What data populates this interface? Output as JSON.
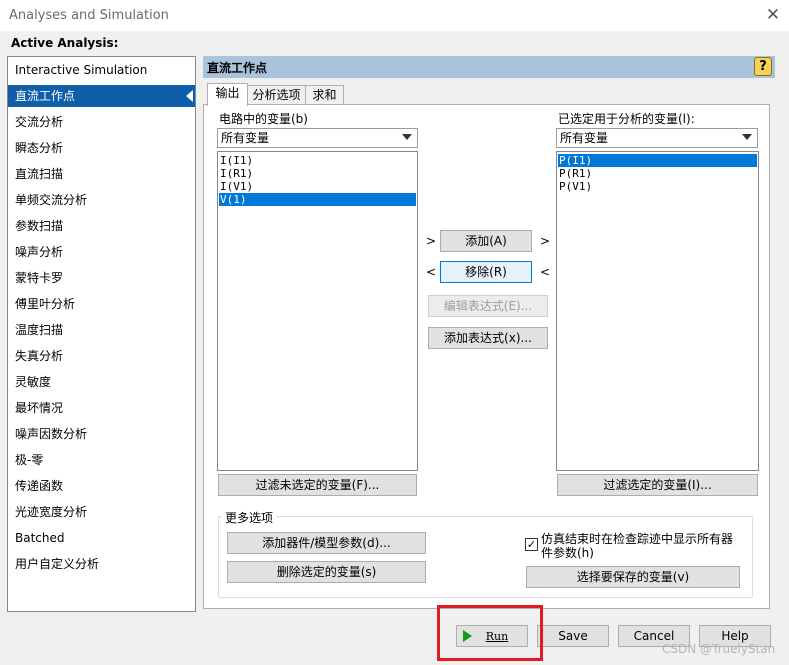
{
  "window": {
    "title": "Analyses and Simulation",
    "close_glyph": "✕"
  },
  "active_analysis_label": "Active Analysis:",
  "analyses": [
    "Interactive Simulation",
    "直流工作点",
    "交流分析",
    "瞬态分析",
    "直流扫描",
    "单频交流分析",
    "参数扫描",
    "噪声分析",
    "蒙特卡罗",
    "傅里叶分析",
    "温度扫描",
    "失真分析",
    "灵敏度",
    "最坏情况",
    "噪声因数分析",
    "极-零",
    "传递函数",
    "光迹宽度分析",
    "Batched",
    "用户自定义分析"
  ],
  "selected_analysis_index": 1,
  "panel": {
    "title": "直流工作点",
    "help_glyph": "?",
    "tabs": [
      "输出",
      "分析选项",
      "求和"
    ],
    "active_tab_index": 0
  },
  "left_list": {
    "label": "电路中的变量(b)",
    "filter_value": "所有变量",
    "items": [
      "I(I1)",
      "I(R1)",
      "I(V1)",
      "V(1)"
    ],
    "selected_index": 3,
    "filter_button": "过滤未选定的变量(F)..."
  },
  "right_list": {
    "label": "已选定用于分析的变量(l):",
    "filter_value": "所有变量",
    "items": [
      "P(I1)",
      "P(R1)",
      "P(V1)"
    ],
    "selected_index": 0,
    "filter_button": "过滤选定的变量(I)..."
  },
  "middle_buttons": {
    "add": "添加(A)",
    "remove": "移除(R)",
    "edit_expr": "编辑表达式(E)...",
    "add_expr": "添加表达式(x)...",
    "chev_right": ">",
    "chev_left": "<"
  },
  "more_options": {
    "title": "更多选项",
    "add_param_button": "添加器件/模型参数(d)...",
    "delete_var_button": "删除选定的变量(s)",
    "checkbox_label": "仿真结束时在检查踪迹中显示所有器件参数(h)",
    "checkbox_checked": true,
    "checkbox_glyph": "✓",
    "select_save_button": "选择要保存的变量(v)"
  },
  "footer": {
    "run": "Run",
    "save": "Save",
    "cancel": "Cancel",
    "help": "Help"
  },
  "watermark": "CSDN @TruelyStan",
  "colors": {
    "selection": "#0f5fa8",
    "header": "#a9c3dc",
    "highlight": "#e01b24",
    "run_icon": "#1a9a1a"
  }
}
